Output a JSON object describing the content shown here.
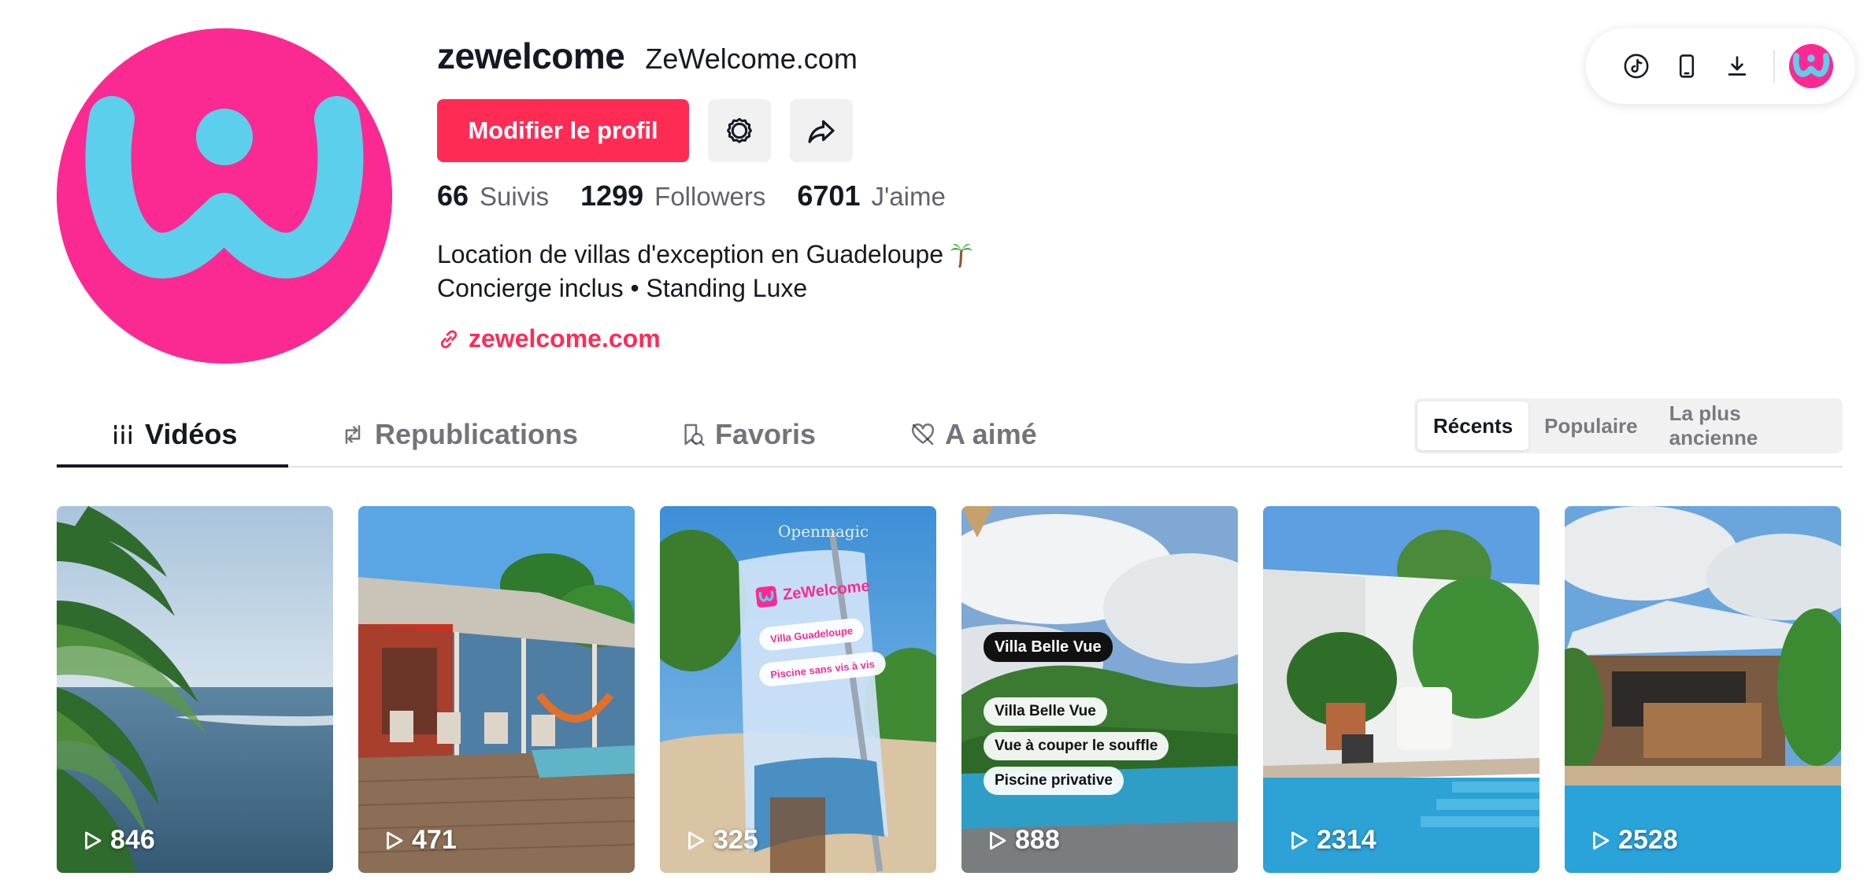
{
  "profile": {
    "username": "zewelcome",
    "nickname": "ZeWelcome.com",
    "edit_button": "Modifier le profil",
    "settings_icon": "gear-icon",
    "share_icon": "share-arrow-icon",
    "stats": [
      {
        "value": "66",
        "label": "Suivis"
      },
      {
        "value": "1299",
        "label": "Followers"
      },
      {
        "value": "6701",
        "label": "J'aime"
      }
    ],
    "bio_line1": "Location de villas d'exception en Guadeloupe",
    "bio_line2": "Concierge inclus • Standing Luxe",
    "link": "zewelcome.com",
    "brand_colors": {
      "avatar_bg": "#fb2a93",
      "logo": "#5bcfec"
    }
  },
  "toolbar": {
    "icons": [
      "tiktok-icon",
      "phone-icon",
      "download-icon"
    ]
  },
  "tabs": [
    {
      "label": "Vidéos",
      "icon": "grid-icon",
      "active": true
    },
    {
      "label": "Republications",
      "icon": "repost-icon",
      "active": false
    },
    {
      "label": "Favoris",
      "icon": "bookmark-icon",
      "active": false
    },
    {
      "label": "A aimé",
      "icon": "heart-icon",
      "active": false
    }
  ],
  "sort": {
    "options": [
      "Récents",
      "Populaire",
      "La plus ancienne"
    ],
    "selected": "Récents"
  },
  "videos": [
    {
      "views": "846"
    },
    {
      "views": "471"
    },
    {
      "views": "325",
      "overlay": {
        "brand": "Openmagic",
        "title": "ZeWelcome",
        "lines": [
          "Villa Guadeloupe",
          "Piscine sans vis à vis"
        ]
      }
    },
    {
      "views": "888",
      "overlay": {
        "title": "Villa Belle Vue",
        "lines": [
          "Villa Belle Vue",
          "Vue à couper le souffle",
          "Piscine privative"
        ]
      }
    },
    {
      "views": "2314"
    },
    {
      "views": "2528"
    }
  ],
  "colors": {
    "accent": "#fe2c55",
    "text": "#161823"
  }
}
